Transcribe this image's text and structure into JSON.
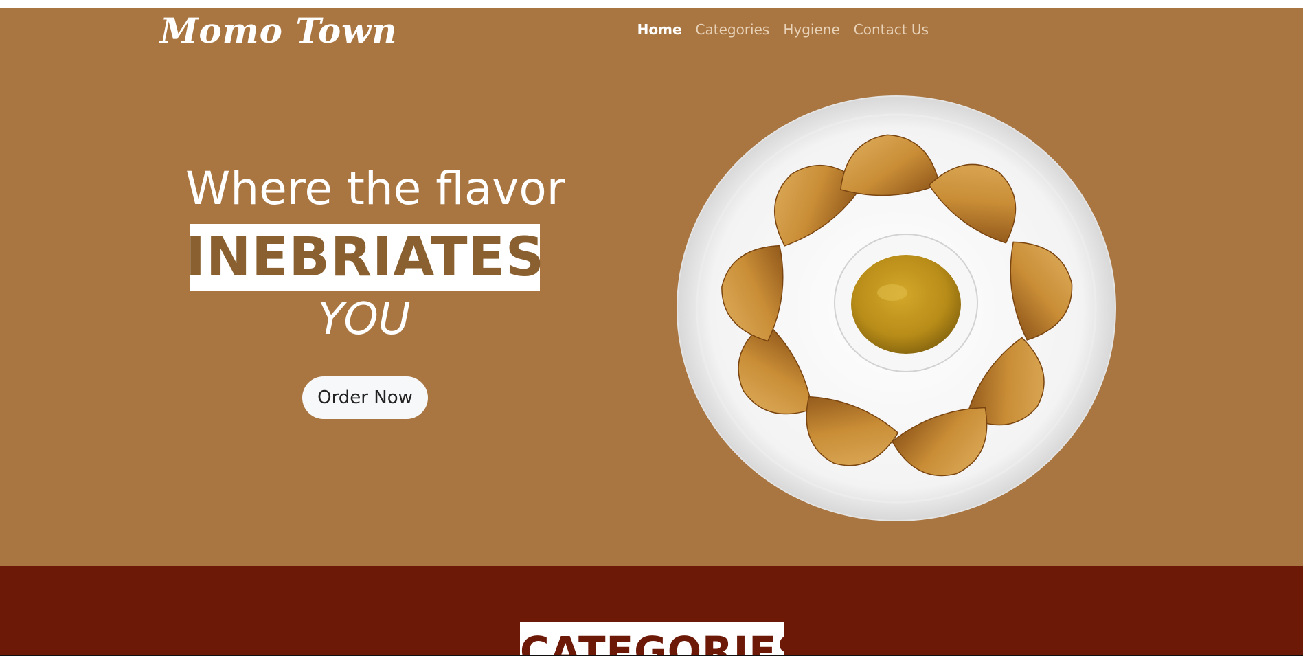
{
  "navbar": {
    "brand": "Momo  Town",
    "links": [
      "Home",
      "Categories",
      "Hygiene",
      "Contact Us"
    ],
    "active_link": "Home"
  },
  "hero": {
    "line1": "Where the flavor",
    "highlight": "INEBRIATES",
    "line3": "YOU",
    "order_button": "Order Now",
    "image_icon": "momo-plate-image"
  },
  "categories_section": {
    "title": "CATEGORIES"
  },
  "colors": {
    "hero_background": "#a97642",
    "section_background": "#6d1908",
    "highlight_text": "#8a6030",
    "button_background": "#f7f8fa"
  }
}
